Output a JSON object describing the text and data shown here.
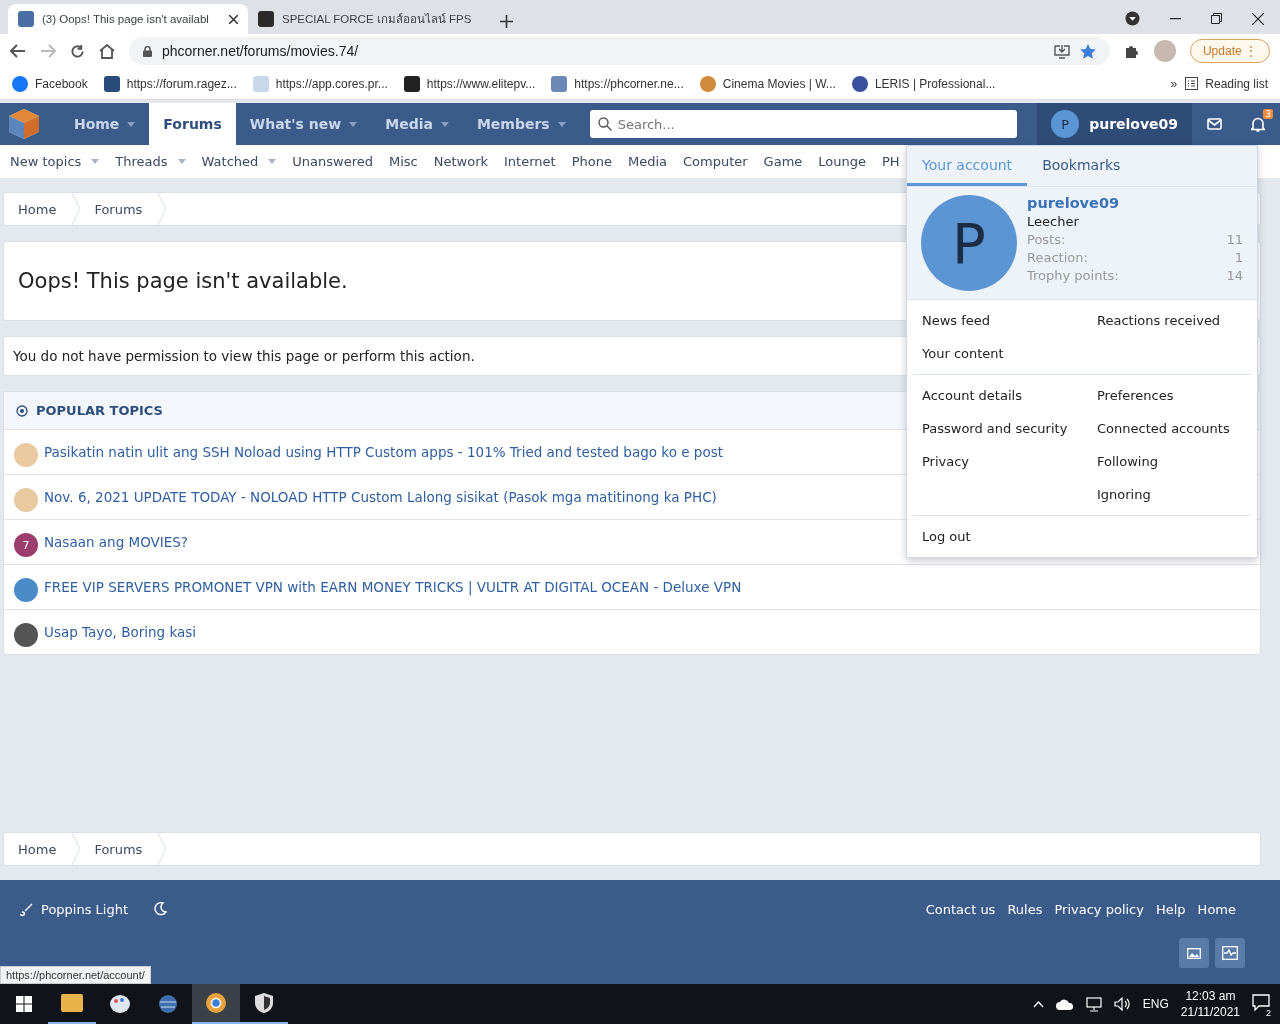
{
  "browser": {
    "tabs": [
      {
        "title": "(3) Oops! This page isn't availabl",
        "selected": true
      },
      {
        "title": "SPECIAL FORCE เกมส์ออนไลน์ FPS",
        "selected": false
      }
    ],
    "address": "phcorner.net/forums/movies.74/",
    "update": "Update",
    "update_menu": "⋮",
    "bookmarks": [
      "Facebook",
      "https://forum.ragez...",
      "https://app.cores.pr...",
      "https://www.elitepv...",
      "https://phcorner.ne...",
      "Cinema Movies | W...",
      "LERIS | Professional..."
    ],
    "overflow": "»",
    "reading_list": "Reading list"
  },
  "site": {
    "nav": [
      {
        "label": "Home",
        "selected": false,
        "dropdown": true
      },
      {
        "label": "Forums",
        "selected": true,
        "dropdown": false
      },
      {
        "label": "What's new",
        "selected": false,
        "dropdown": true
      },
      {
        "label": "Media",
        "selected": false,
        "dropdown": true
      },
      {
        "label": "Members",
        "selected": false,
        "dropdown": true
      }
    ],
    "search": {
      "placeholder": "Search..."
    },
    "user": {
      "avatar_letter": "P",
      "name": "purelove09"
    },
    "alerts_badge": "3",
    "subnav": [
      {
        "label": "New topics",
        "dropdown": true
      },
      {
        "label": "Threads",
        "dropdown": true
      },
      {
        "label": "Watched",
        "dropdown": true
      },
      {
        "label": "Unanswered",
        "dropdown": false
      },
      {
        "label": "Misc",
        "dropdown": false
      },
      {
        "label": "Network",
        "dropdown": false
      },
      {
        "label": "Internet",
        "dropdown": false
      },
      {
        "label": "Phone",
        "dropdown": false
      },
      {
        "label": "Media",
        "dropdown": false
      },
      {
        "label": "Computer",
        "dropdown": false
      },
      {
        "label": "Game",
        "dropdown": false
      },
      {
        "label": "Lounge",
        "dropdown": false
      },
      {
        "label": "PH",
        "dropdown": false
      }
    ]
  },
  "breadcrumbs_top": [
    "Home",
    "Forums"
  ],
  "error": {
    "title": "Oops! This page isn't available.",
    "message": "You do not have permission to view this page or perform this action."
  },
  "popular": {
    "title": "POPULAR TOPICS",
    "topics": [
      {
        "title": "Pasikatin natin ulit ang SSH Noload using HTTP Custom apps - 101% Tried and tested bago ko e post",
        "kind": "image",
        "color": "#e8c9a0"
      },
      {
        "title": "Nov. 6, 2021 UPDATE TODAY - NOLOAD HTTP Custom Lalong sisikat (Pasok mga matitinong ka PHC)",
        "kind": "image",
        "color": "#e8c9a0"
      },
      {
        "title": "Nasaan ang MOVIES?",
        "kind": "letter",
        "letter": "7",
        "color": "#9c3d6e"
      },
      {
        "title": "FREE VIP SERVERS PROMONET VPN with EARN MONEY TRICKS | VULTR AT DIGITAL OCEAN - Deluxe VPN",
        "kind": "image",
        "color": "#4a8cc9"
      },
      {
        "title": "Usap Tayo, Boring kasi",
        "kind": "image",
        "color": "#555555"
      }
    ]
  },
  "account_menu": {
    "tabs": [
      {
        "label": "Your account",
        "selected": true
      },
      {
        "label": "Bookmarks",
        "selected": false
      }
    ],
    "avatar_letter": "P",
    "name": "purelove09",
    "rank": "Leecher",
    "stats": [
      {
        "label": "Posts:",
        "value": "11"
      },
      {
        "label": "Reaction:",
        "value": "1"
      },
      {
        "label": "Trophy points:",
        "value": "14"
      }
    ],
    "sections": [
      {
        "left": [
          "News feed",
          "Your content"
        ],
        "right": [
          "Reactions received"
        ]
      },
      {
        "left": [
          "Account details",
          "Password and security",
          "Privacy"
        ],
        "right": [
          "Preferences",
          "Connected accounts",
          "Following",
          "Ignoring"
        ]
      },
      {
        "left": [
          "Log out"
        ]
      }
    ]
  },
  "breadcrumbs_bottom": [
    "Home",
    "Forums"
  ],
  "footer": {
    "style": "Poppins Light",
    "links": [
      "Contact us",
      "Rules",
      "Privacy policy",
      "Help",
      "Home"
    ]
  },
  "status_url": "https://phcorner.net/account/",
  "taskbar": {
    "language": "ENG",
    "time": "12:03 am",
    "date": "21/11/2021",
    "notifications": "2"
  }
}
